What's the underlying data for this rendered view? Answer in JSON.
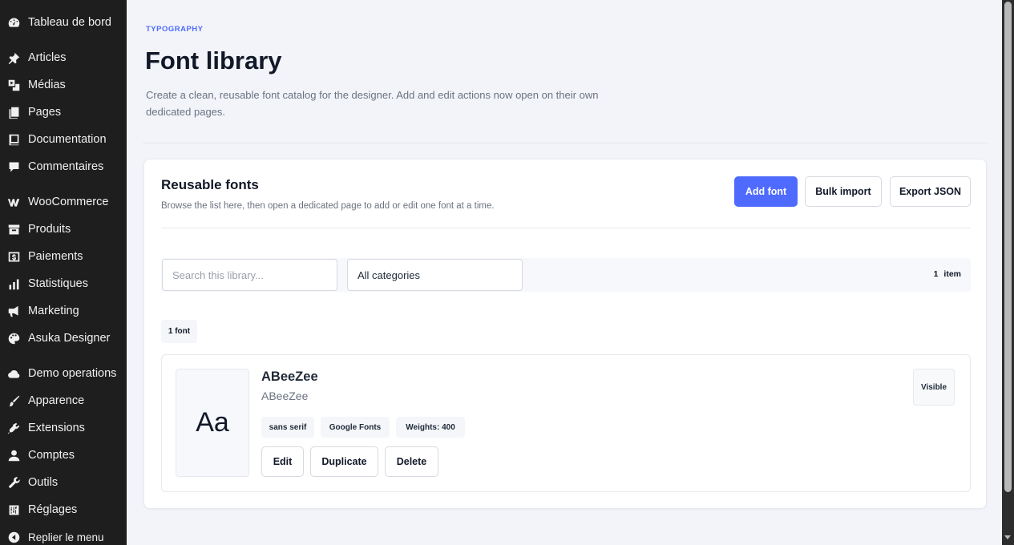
{
  "sidebar": {
    "items": [
      {
        "label": "Tableau de bord",
        "icon": "dashboard-icon"
      },
      {
        "label": "Articles",
        "icon": "pin-icon"
      },
      {
        "label": "Médias",
        "icon": "media-icon"
      },
      {
        "label": "Pages",
        "icon": "pages-icon"
      },
      {
        "label": "Documentation",
        "icon": "book-icon"
      },
      {
        "label": "Commentaires",
        "icon": "comment-icon"
      },
      {
        "label": "WooCommerce",
        "icon": "woocommerce-icon"
      },
      {
        "label": "Produits",
        "icon": "archive-icon"
      },
      {
        "label": "Paiements",
        "icon": "payment-icon"
      },
      {
        "label": "Statistiques",
        "icon": "bar-chart-icon"
      },
      {
        "label": "Marketing",
        "icon": "megaphone-icon"
      },
      {
        "label": "Asuka Designer",
        "icon": "palette-icon"
      },
      {
        "label": "Demo operations",
        "icon": "cloud-icon"
      },
      {
        "label": "Apparence",
        "icon": "brush-icon"
      },
      {
        "label": "Extensions",
        "icon": "plugin-icon"
      },
      {
        "label": "Comptes",
        "icon": "user-icon"
      },
      {
        "label": "Outils",
        "icon": "wrench-icon"
      },
      {
        "label": "Réglages",
        "icon": "settings-icon"
      },
      {
        "label": "Replier le menu",
        "icon": "collapse-icon"
      }
    ]
  },
  "header": {
    "eyebrow": "TYPOGRAPHY",
    "title": "Font library",
    "description": "Create a clean, reusable font catalog for the designer. Add and edit actions now open on their own dedicated pages."
  },
  "library": {
    "title": "Reusable fonts",
    "subtitle": "Browse the list here, then open a dedicated page to add or edit one font at a time.",
    "add_label": "Add font",
    "bulk_label": "Bulk import",
    "export_label": "Export JSON",
    "search_placeholder": "Search this library...",
    "category_value": "All categories",
    "count_number": "1",
    "count_unit": "item",
    "font_count": "1 font",
    "accent_color": "#4f6bff"
  },
  "font": {
    "preview": "Aa",
    "name": "ABeeZee",
    "family": "ABeeZee",
    "tags": [
      "sans serif",
      "Google Fonts",
      "Weights: 400"
    ],
    "edit_label": "Edit",
    "duplicate_label": "Duplicate",
    "delete_label": "Delete",
    "status": "Visible"
  }
}
